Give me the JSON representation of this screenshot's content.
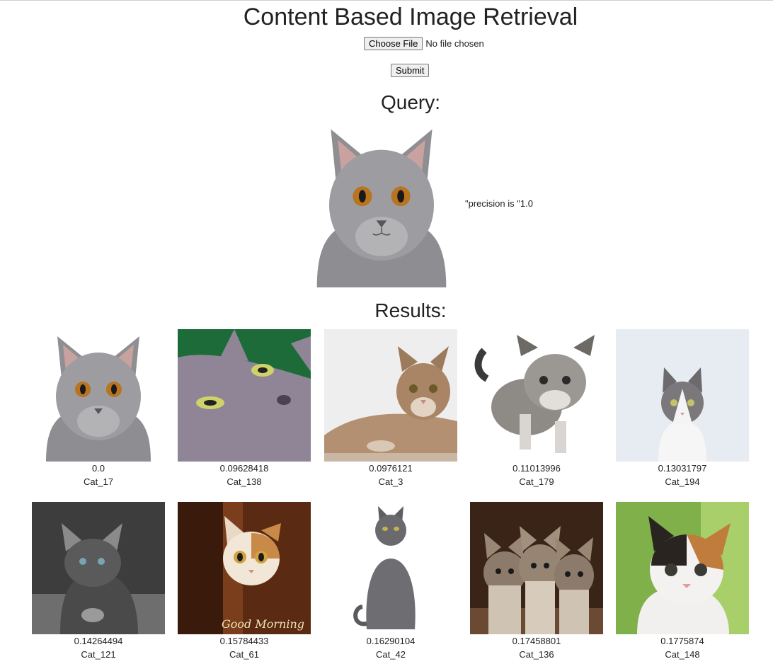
{
  "page": {
    "title": "Content Based Image Retrieval",
    "choose_file_label": "Choose File",
    "file_status": "No file chosen",
    "submit_label": "Submit",
    "query_heading": "Query:",
    "precision_text": "\"precision is \"1.0",
    "results_heading": "Results:"
  },
  "results": [
    {
      "score": "0.0",
      "name": "Cat_17"
    },
    {
      "score": "0.09628418",
      "name": "Cat_138"
    },
    {
      "score": "0.0976121",
      "name": "Cat_3"
    },
    {
      "score": "0.11013996",
      "name": "Cat_179"
    },
    {
      "score": "0.13031797",
      "name": "Cat_194"
    },
    {
      "score": "0.14264494",
      "name": "Cat_121"
    },
    {
      "score": "0.15784433",
      "name": "Cat_61"
    },
    {
      "score": "0.16290104",
      "name": "Cat_42"
    },
    {
      "score": "0.17458801",
      "name": "Cat_136"
    },
    {
      "score": "0.1775874",
      "name": "Cat_148"
    }
  ],
  "image_labels": {
    "cat_61_caption": "Good Morning"
  },
  "colors": {
    "gray_cat": "#9a9a9e",
    "eye_amber": "#b8741f",
    "green_bg": "#1e6b3a",
    "brown_bg": "#5a2a12"
  }
}
